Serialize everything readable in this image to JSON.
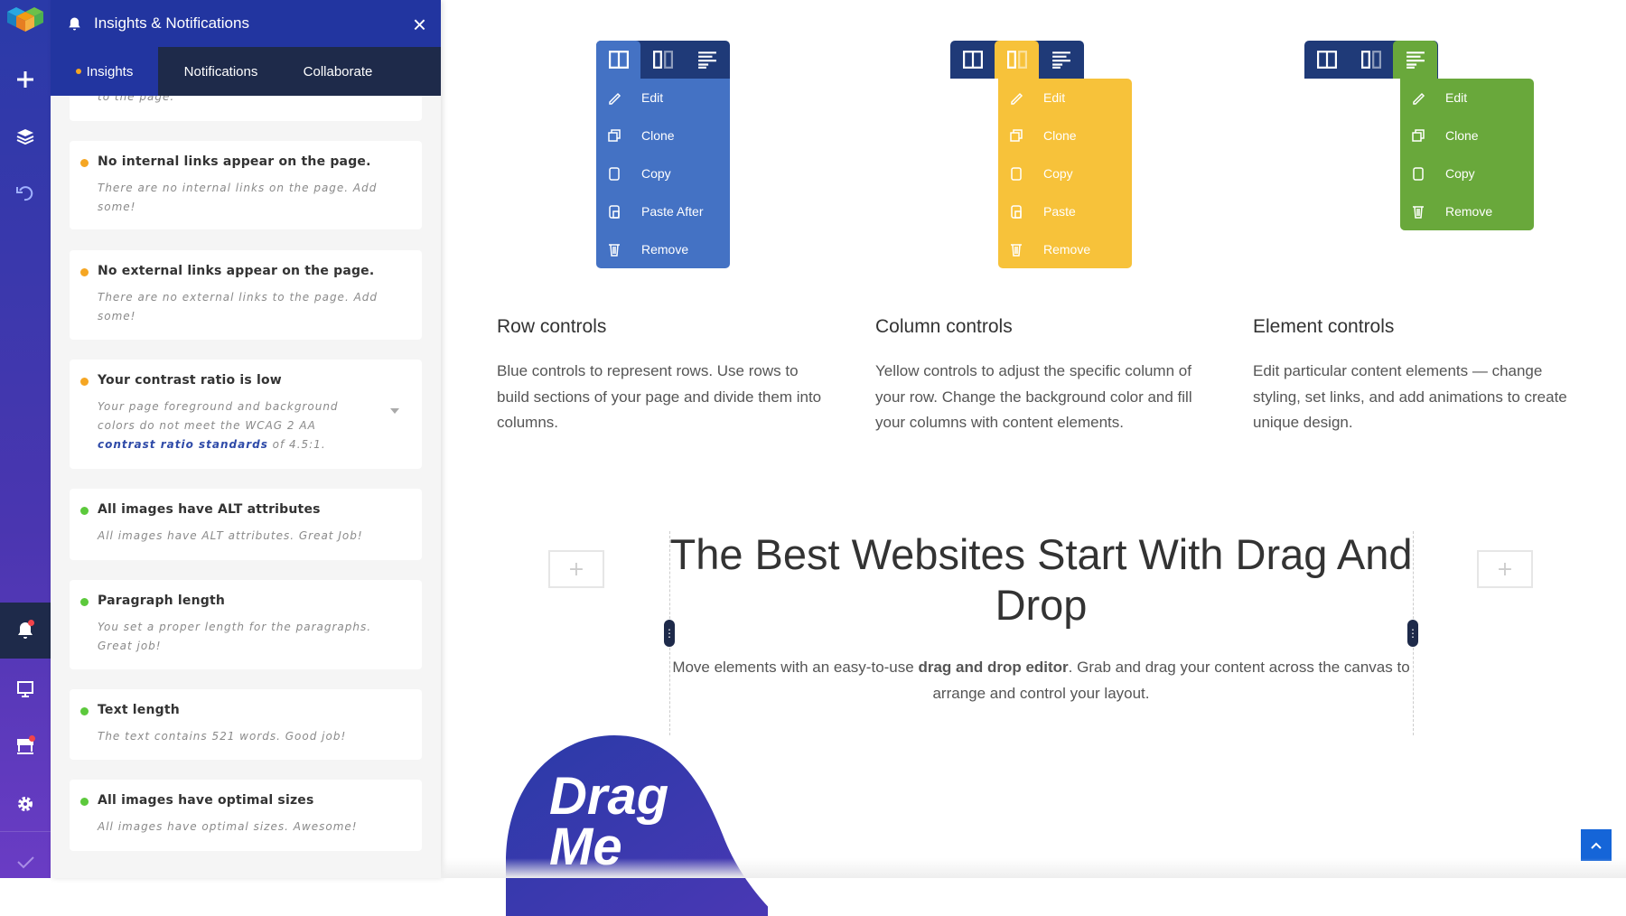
{
  "panel": {
    "title": "Insights & Notifications",
    "close": "×",
    "tabs": [
      {
        "label": "Insights"
      },
      {
        "label": "Notifications"
      },
      {
        "label": "Collaborate"
      }
    ],
    "partial_text": "to the page.",
    "cards": [
      {
        "title": "No internal links appear on the page.",
        "desc": "There are no internal links on the page. Add some!",
        "status": "warning"
      },
      {
        "title": "No external links appear on the page.",
        "desc": "There are no external links to the page. Add some!",
        "status": "warning"
      },
      {
        "title": "Your contrast ratio is low",
        "desc_pre": "Your page foreground and background colors do not meet the WCAG 2 AA ",
        "link": "contrast ratio standards",
        "desc_post": " of 4.5:1.",
        "status": "warning"
      },
      {
        "title": "All images have ALT attributes",
        "desc": "All images have ALT attributes. Great Job!",
        "status": "ok"
      },
      {
        "title": "Paragraph length",
        "desc": "You set a proper length for the paragraphs. Great job!",
        "status": "ok"
      },
      {
        "title": "Text length",
        "desc": "The text contains 521 words. Good job!",
        "status": "ok"
      },
      {
        "title": "All images have optimal sizes",
        "desc": "All images have optimal sizes. Awesome!",
        "status": "ok"
      }
    ]
  },
  "colors": {
    "warning": "#f5a623",
    "ok": "#5cc93c",
    "row": "#4472c4",
    "column": "#f7c23a",
    "element": "#69a83b",
    "toolbar": "#1f3a78"
  },
  "controls": {
    "row": {
      "items": [
        "Edit",
        "Clone",
        "Copy",
        "Paste After",
        "Remove"
      ],
      "heading": "Row controls",
      "text": "Blue controls to represent rows. Use rows to build sections of your page and divide them into columns."
    },
    "column": {
      "items": [
        "Edit",
        "Clone",
        "Copy",
        "Paste",
        "Remove"
      ],
      "heading": "Column controls",
      "text": "Yellow controls to adjust the specific column of your row. Change the background color and fill your columns with content elements."
    },
    "element": {
      "items": [
        "Edit",
        "Clone",
        "Copy",
        "Remove"
      ],
      "heading": "Element controls",
      "text": "Edit particular content elements — change styling, set links, and add animations to create unique design."
    }
  },
  "hero": {
    "title": "The Best Websites Start With Drag And Drop",
    "sub_pre": "Move elements with an easy-to-use ",
    "sub_bold": "drag and drop editor",
    "sub_post": ". Grab and drag your content across the canvas to arrange and control your layout.",
    "blob_text": "Drag Me"
  }
}
